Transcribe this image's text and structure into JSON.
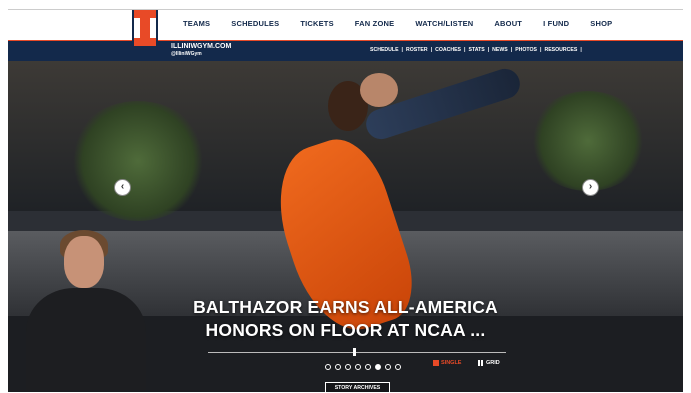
{
  "nav": {
    "items": [
      {
        "label": "TEAMS"
      },
      {
        "label": "SCHEDULES"
      },
      {
        "label": "TICKETS"
      },
      {
        "label": "FAN ZONE"
      },
      {
        "label": "WATCH/LISTEN"
      },
      {
        "label": "ABOUT"
      },
      {
        "label": "I FUND"
      },
      {
        "label": "SHOP"
      }
    ]
  },
  "site": {
    "name": "ILLINIWGYM.COM",
    "handle": "@IlliniWGym"
  },
  "subnav": {
    "items": [
      {
        "label": "SCHEDULE"
      },
      {
        "label": "ROSTER"
      },
      {
        "label": "COACHES"
      },
      {
        "label": "STATS"
      },
      {
        "label": "NEWS"
      },
      {
        "label": "PHOTOS"
      },
      {
        "label": "RESOURCES"
      }
    ],
    "separator": "|"
  },
  "hero": {
    "headline_line1": "BALTHAZOR EARNS ALL-AMERICA",
    "headline_line2": "HONORS ON FLOOR AT NCAA ...",
    "prev_icon": "chevron-left-icon",
    "next_icon": "chevron-right-icon",
    "active_slide": 6,
    "slide_count": 8,
    "single_label": "SINGLE",
    "grid_label": "GRID",
    "archives_label": "STORY ARCHIVES"
  },
  "colors": {
    "orange": "#e84a27",
    "navy": "#13294b"
  }
}
